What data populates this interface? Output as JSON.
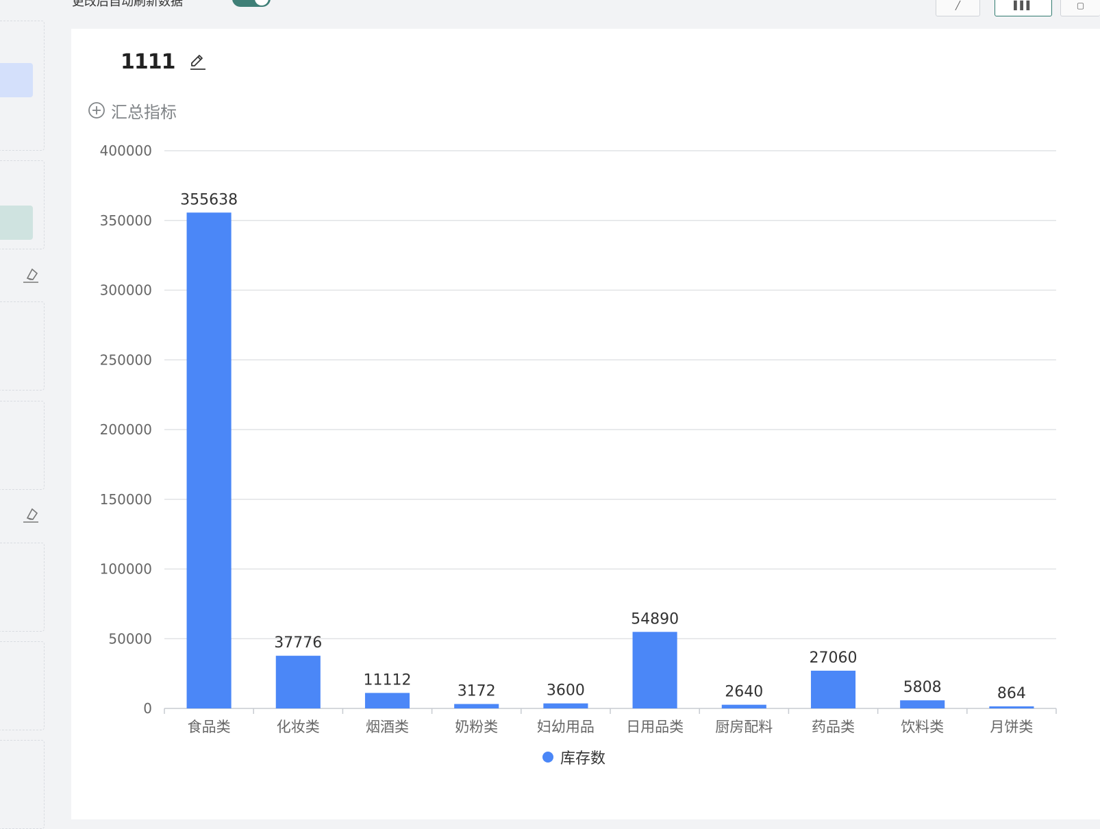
{
  "top": {
    "auto_refresh_label": "更改后自动刷新数据",
    "auto_refresh_on": true
  },
  "colors": {
    "bar": "#4b87f7",
    "accent": "#3f7f77",
    "chip_blue": "#d4e0fb",
    "chip_teal": "#cfe3e0"
  },
  "summary": {
    "label": "汇总指标",
    "icon": "plus-circle-icon"
  },
  "icons": {
    "edit": "pencil-icon",
    "clear": "eraser-icon"
  },
  "chart_data": {
    "type": "bar",
    "title": "1111",
    "xlabel": "",
    "ylabel": "",
    "categories": [
      "食品类",
      "化妆类",
      "烟酒类",
      "奶粉类",
      "妇幼用品",
      "日用品类",
      "厨房配料",
      "药品类",
      "饮料类",
      "月饼类"
    ],
    "series": [
      {
        "name": "库存数",
        "color": "#4b87f7",
        "values": [
          355638,
          37776,
          11112,
          3172,
          3600,
          54890,
          2640,
          27060,
          5808,
          864
        ]
      }
    ],
    "ylim": [
      0,
      400000
    ],
    "yticks": [
      0,
      50000,
      100000,
      150000,
      200000,
      250000,
      300000,
      350000,
      400000
    ],
    "grid": true,
    "legend_position": "bottom",
    "data_labels": true
  }
}
